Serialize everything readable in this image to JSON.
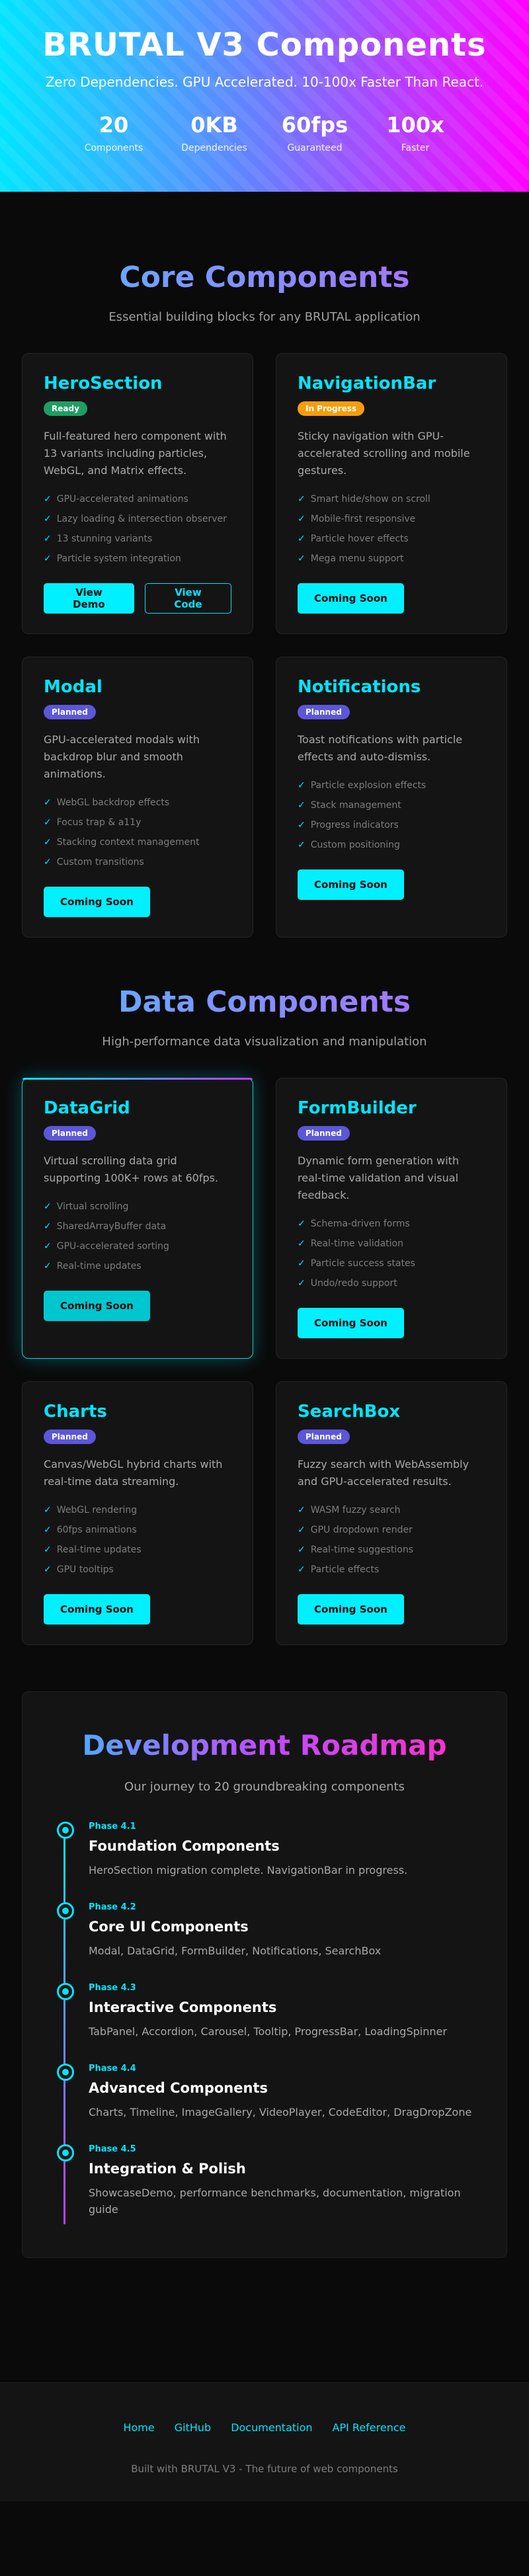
{
  "hero": {
    "title": "BRUTAL V3 Components",
    "subtitle": "Zero Dependencies. GPU Accelerated. 10-100x Faster Than React.",
    "stats": [
      {
        "value": "20",
        "label": "Components"
      },
      {
        "value": "0KB",
        "label": "Dependencies"
      },
      {
        "value": "60fps",
        "label": "Guaranteed"
      },
      {
        "value": "100x",
        "label": "Faster"
      }
    ]
  },
  "core": {
    "title": "Core Components",
    "subtitle": "Essential building blocks for any BRUTAL application",
    "cards": [
      {
        "title": "HeroSection",
        "badge": "Ready",
        "desc": "Full-featured hero component with 13 variants including particles, WebGL, and Matrix effects.",
        "features": [
          "GPU-accelerated animations",
          "Lazy loading & intersection observer",
          "13 stunning variants",
          "Particle system integration"
        ],
        "buttons": [
          "View Demo",
          "View Code"
        ]
      },
      {
        "title": "NavigationBar",
        "badge": "In Progress",
        "desc": "Sticky navigation with GPU-accelerated scrolling and mobile gestures.",
        "features": [
          "Smart hide/show on scroll",
          "Mobile-first responsive",
          "Particle hover effects",
          "Mega menu support"
        ],
        "buttons": [
          "Coming Soon"
        ]
      },
      {
        "title": "Modal",
        "badge": "Planned",
        "desc": "GPU-accelerated modals with backdrop blur and smooth animations.",
        "features": [
          "WebGL backdrop effects",
          "Focus trap & a11y",
          "Stacking context management",
          "Custom transitions"
        ],
        "buttons": [
          "Coming Soon"
        ]
      },
      {
        "title": "Notifications",
        "badge": "Planned",
        "desc": "Toast notifications with particle effects and auto-dismiss.",
        "features": [
          "Particle explosion effects",
          "Stack management",
          "Progress indicators",
          "Custom positioning"
        ],
        "buttons": [
          "Coming Soon"
        ]
      }
    ]
  },
  "data": {
    "title": "Data Components",
    "subtitle": "High-performance data visualization and manipulation",
    "cards": [
      {
        "title": "DataGrid",
        "badge": "Planned",
        "desc": "Virtual scrolling data grid supporting 100K+ rows at 60fps.",
        "features": [
          "Virtual scrolling",
          "SharedArrayBuffer data",
          "GPU-accelerated sorting",
          "Real-time updates"
        ],
        "buttons": [
          "Coming Soon"
        ]
      },
      {
        "title": "FormBuilder",
        "badge": "Planned",
        "desc": "Dynamic form generation with real-time validation and visual feedback.",
        "features": [
          "Schema-driven forms",
          "Real-time validation",
          "Particle success states",
          "Undo/redo support"
        ],
        "buttons": [
          "Coming Soon"
        ]
      },
      {
        "title": "Charts",
        "badge": "Planned",
        "desc": "Canvas/WebGL hybrid charts with real-time data streaming.",
        "features": [
          "WebGL rendering",
          "60fps animations",
          "Real-time updates",
          "GPU tooltips"
        ],
        "buttons": [
          "Coming Soon"
        ]
      },
      {
        "title": "SearchBox",
        "badge": "Planned",
        "desc": "Fuzzy search with WebAssembly and GPU-accelerated results.",
        "features": [
          "WASM fuzzy search",
          "GPU dropdown render",
          "Real-time suggestions",
          "Particle effects"
        ],
        "buttons": [
          "Coming Soon"
        ]
      }
    ]
  },
  "roadmap": {
    "title": "Development Roadmap",
    "subtitle": "Our journey to 20 groundbreaking components",
    "phases": [
      {
        "label": "Phase 4.1",
        "title": "Foundation Components",
        "desc": "HeroSection migration complete. NavigationBar in progress."
      },
      {
        "label": "Phase 4.2",
        "title": "Core UI Components",
        "desc": "Modal, DataGrid, FormBuilder, Notifications, SearchBox"
      },
      {
        "label": "Phase 4.3",
        "title": "Interactive Components",
        "desc": "TabPanel, Accordion, Carousel, Tooltip, ProgressBar, LoadingSpinner"
      },
      {
        "label": "Phase 4.4",
        "title": "Advanced Components",
        "desc": "Charts, Timeline, ImageGallery, VideoPlayer, CodeEditor, DragDropZone"
      },
      {
        "label": "Phase 4.5",
        "title": "Integration & Polish",
        "desc": "ShowcaseDemo, performance benchmarks, documentation, migration guide"
      }
    ]
  },
  "footer": {
    "links": [
      "Home",
      "GitHub",
      "Documentation",
      "API Reference"
    ],
    "copy": "Built with BRUTAL V3 - The future of web components"
  },
  "colors": {
    "accent": "#00e5ff",
    "ready": "#1f9e63",
    "in_progress": "#f59e0b",
    "planned": "#5b57d9"
  }
}
